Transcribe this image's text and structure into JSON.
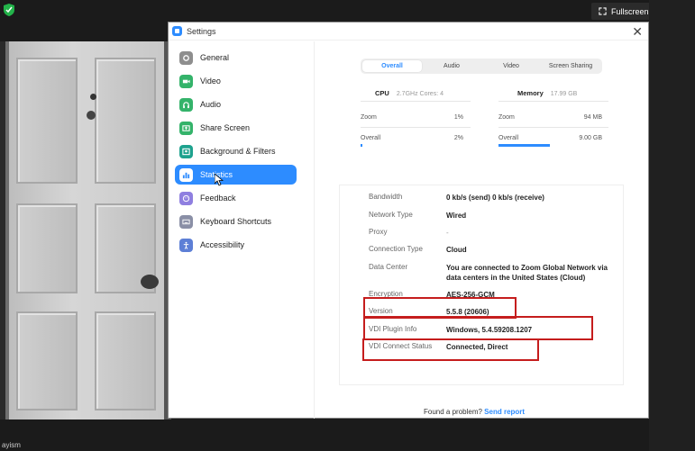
{
  "video": {
    "fullscreen_label": "Fullscreen",
    "participant_name": "ayism"
  },
  "window": {
    "title": "Settings",
    "close_glyph": "✕"
  },
  "sidebar": {
    "items": [
      {
        "label": "General",
        "icon": "gear-icon",
        "color": "#8e8e8e"
      },
      {
        "label": "Video",
        "icon": "video-icon",
        "color": "#34b36a"
      },
      {
        "label": "Audio",
        "icon": "headphones-icon",
        "color": "#34b36a"
      },
      {
        "label": "Share Screen",
        "icon": "share-screen-icon",
        "color": "#34b36a"
      },
      {
        "label": "Background & Filters",
        "icon": "background-icon",
        "color": "#1ea28e"
      },
      {
        "label": "Statistics",
        "icon": "statistics-icon",
        "color": "#2d8cff",
        "active": true
      },
      {
        "label": "Feedback",
        "icon": "feedback-icon",
        "color": "#8f7fe0"
      },
      {
        "label": "Keyboard Shortcuts",
        "icon": "keyboard-icon",
        "color": "#8a8fa6"
      },
      {
        "label": "Accessibility",
        "icon": "accessibility-icon",
        "color": "#5d7fd6"
      }
    ]
  },
  "tabs": [
    "Overall",
    "Audio",
    "Video",
    "Screen Sharing"
  ],
  "resources": {
    "cpu": {
      "title": "CPU",
      "detail": "2.7GHz  Cores: 4"
    },
    "memory": {
      "title": "Memory",
      "detail": "17.99 GB"
    },
    "cpu_rows": [
      {
        "label": "Zoom",
        "value": "1%",
        "usage": 0.01
      },
      {
        "label": "Overall",
        "value": "2%",
        "usage": 0.02
      }
    ],
    "memory_rows": [
      {
        "label": "Zoom",
        "value": "94 MB",
        "usage": 0.0
      },
      {
        "label": "Overall",
        "value": "9.00 GB",
        "usage": 0.5
      }
    ]
  },
  "stats": [
    {
      "label": "Bandwidth",
      "value": "0 kb/s (send)   0 kb/s (receive)"
    },
    {
      "label": "Network Type",
      "value": "Wired"
    },
    {
      "label": "Proxy",
      "value": "-"
    },
    {
      "label": "Connection Type",
      "value": "Cloud"
    },
    {
      "label": "Data Center",
      "value": "You are connected to Zoom Global Network via data centers in the United States (Cloud)"
    },
    {
      "label": "Encryption",
      "value": "AES-256-GCM"
    },
    {
      "label": "Version",
      "value": "5.5.8 (20606)"
    },
    {
      "label": "VDI Plugin Info",
      "value": "Windows, 5.4.59208.1207"
    },
    {
      "label": "VDI Connect Status",
      "value": "Connected, Direct"
    }
  ],
  "footer": {
    "text": "Found a problem?",
    "link": "Send report"
  },
  "colors": {
    "accent": "#2d8cff",
    "highlight": "#c51d1d"
  }
}
